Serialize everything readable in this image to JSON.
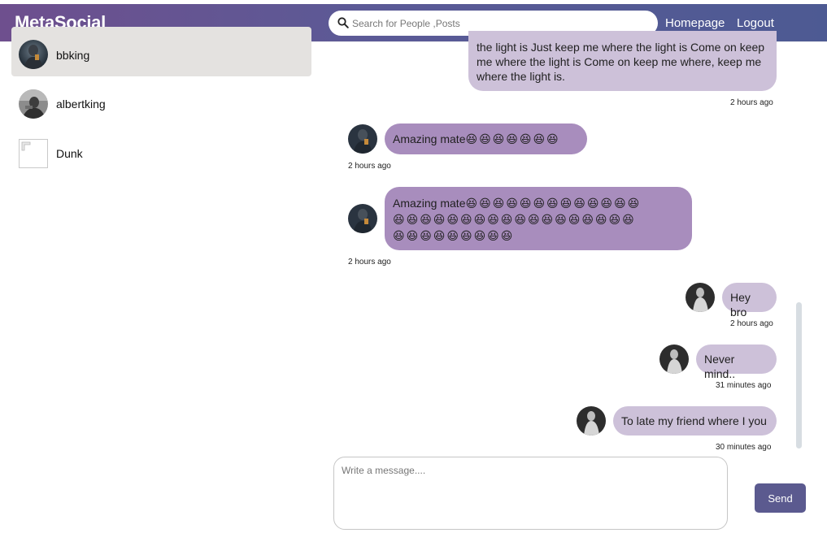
{
  "header": {
    "brand": "MetaSocial",
    "search": {
      "placeholder": "Search for People ,Posts",
      "value": ""
    },
    "nav": [
      "Homepage",
      "Logout"
    ]
  },
  "sidebar": {
    "contacts": [
      {
        "name": "bbking",
        "active": true,
        "avatar": "avatar-photo-dark"
      },
      {
        "name": "albertking",
        "active": false,
        "avatar": "avatar-photo-gray"
      },
      {
        "name": "Dunk",
        "active": false,
        "avatar": "broken-image"
      }
    ]
  },
  "chat": {
    "messages": [
      {
        "own": true,
        "text": "the light is Just keep me where the light is Come on keep me where the light is Come on keep me where, keep me where the light is.",
        "time": "2 hours ago"
      },
      {
        "own": false,
        "text": "Amazing mate",
        "emoji": "😆😆😆😆😆😆😆",
        "time": "2 hours ago"
      },
      {
        "own": false,
        "text": "Amazing mate",
        "emoji_lines": [
          "😆😆😆😆😆😆😆😆😆😆😆😆😆",
          "😆😆😆😆😆😆😆😆😆😆😆😆😆😆😆😆😆😆",
          "😆😆😆😆😆😆😆😆😆"
        ],
        "time": "2 hours ago"
      },
      {
        "own": true,
        "text": "Hey bro",
        "time": "2 hours ago"
      },
      {
        "own": true,
        "text": "Never mind..",
        "time": "31 minutes ago"
      },
      {
        "own": true,
        "text": "To late my friend where I you",
        "time": "30 minutes ago"
      }
    ]
  },
  "composer": {
    "placeholder": "Write a message....",
    "value": "",
    "send_label": "Send"
  },
  "colors": {
    "header_gradient_start": "#6e4f8e",
    "header_gradient_end": "#4d5a93",
    "own_bubble": "#cdc1d9",
    "other_bubble": "#a88dbd",
    "send_button": "#5b5a8f",
    "active_contact": "#e4e2e0"
  }
}
